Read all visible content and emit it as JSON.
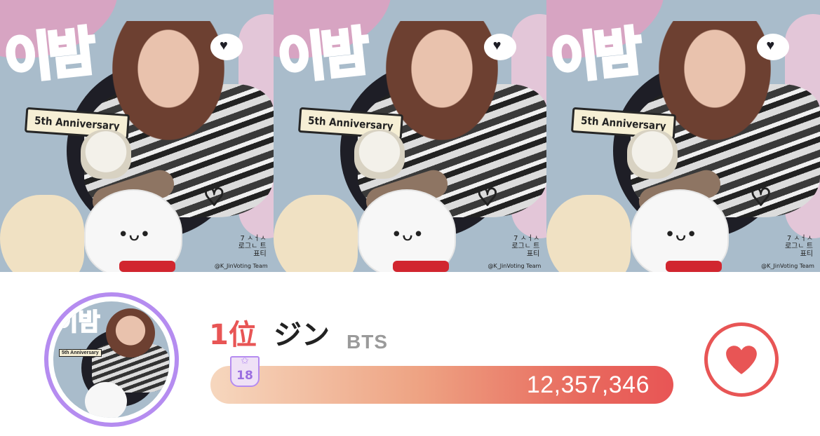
{
  "banner": {
    "panels": [
      {
        "korean_text": "이밤",
        "anniversary_text": "5th Anniversary",
        "credit": "@K_JinVoting Team",
        "side_text": "7 ㅅㅓㅅ 로그ㄴ 트표티"
      },
      {
        "korean_text": "이밤",
        "anniversary_text": "5th Anniversary",
        "credit": "@K_JinVoting Team",
        "side_text": "7 ㅅㅓㅅ 로그ㄴ 트표티"
      },
      {
        "korean_text": "이밤",
        "anniversary_text": "5th Anniversary",
        "credit": "@K_JinVoting Team",
        "side_text": "7 ㅅㅓㅅ 로그ㄴ 트표티"
      }
    ]
  },
  "ranking": {
    "rank": "1位",
    "name": "ジン",
    "group": "BTS",
    "badge_number": "18",
    "votes": "12,357,346",
    "avatar": {
      "korean_text": "이밤",
      "anniversary_text": "5th Anniversary"
    }
  },
  "colors": {
    "accent_red": "#e85555",
    "badge_purple": "#b58cf0",
    "bar_start": "#f6d7be",
    "bar_end": "#e85555"
  },
  "icons": {
    "like": "heart-icon",
    "badge": "star-icon"
  }
}
